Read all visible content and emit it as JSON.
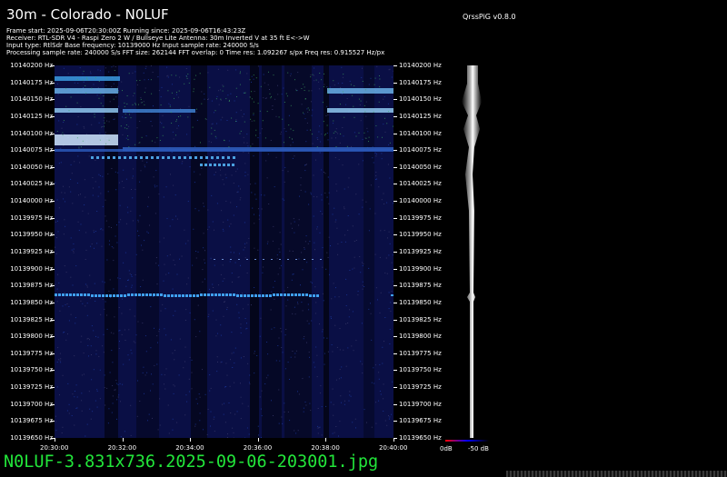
{
  "title": "30m - Colorado - N0LUF",
  "version": "QrssPiG v0.8.0",
  "info_lines": [
    "Frame start: 2025-09-06T20:30:00Z Running since: 2025-09-06T16:43:23Z",
    "Receiver: RTL-SDR V4 - Raspi Zero 2 W / Bullseye Lite Antenna: 30m Inverted V at 35 ft E<->W",
    "Input type: RtlSdr Base frequency: 10139000 Hz Input sample rate: 240000 S/s",
    "Processing sample rate: 240000 S/s FFT size: 262144 FFT overlap: 0 Time res: 1.092267 s/px Freq res: 0.915527 Hz/px"
  ],
  "frequency_labels": [
    "10140200 Hz",
    "10140175 Hz",
    "10140150 Hz",
    "10140125 Hz",
    "10140100 Hz",
    "10140075 Hz",
    "10140050 Hz",
    "10140025 Hz",
    "10140000 Hz",
    "10139975 Hz",
    "10139950 Hz",
    "10139925 Hz",
    "10139900 Hz",
    "10139875 Hz",
    "10139850 Hz",
    "10139825 Hz",
    "10139800 Hz",
    "10139775 Hz",
    "10139750 Hz",
    "10139725 Hz",
    "10139700 Hz",
    "10139675 Hz",
    "10139650 Hz"
  ],
  "time_labels": [
    "20:30:00",
    "20:32:00",
    "20:34:00",
    "20:36:00",
    "20:38:00",
    "20:40:00"
  ],
  "db_labels": [
    "0dB",
    "-50 dB"
  ],
  "filename": "N0LUF-3.831x736.2025-09-06-203001.jpg",
  "colors": {
    "background": "#000000",
    "waterfall_base": "#0a0f45",
    "signal": "#3a8fe0",
    "filename_text": "#22e53a"
  }
}
